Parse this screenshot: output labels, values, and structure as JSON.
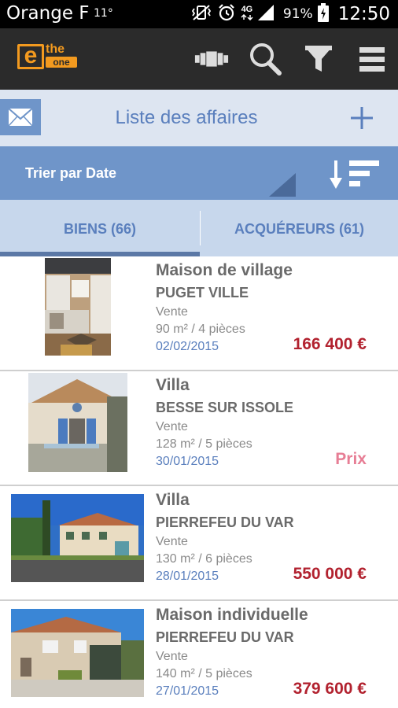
{
  "status_bar": {
    "carrier": "Orange F",
    "temperature": "11°",
    "network": "4G",
    "battery": "91%",
    "time": "12:50"
  },
  "app_bar": {
    "logo_text_top": "the",
    "logo_text_bottom": "one",
    "logo_letter": "e",
    "colors": {
      "background": "#2b2b2b",
      "logo": "#f39a1f"
    }
  },
  "header": {
    "title": "Liste des affaires"
  },
  "sort": {
    "label": "Trier par Date"
  },
  "tabs": [
    {
      "label": "BIENS (66)",
      "active": true
    },
    {
      "label": "ACQUÉREURS (61)",
      "active": false
    }
  ],
  "listings": [
    {
      "type": "Maison de village",
      "city": "PUGET VILLE",
      "deal": "Vente",
      "size": "90 m² / 4 pièces",
      "date": "02/02/2015",
      "price": "166 400 €"
    },
    {
      "type": "Villa",
      "city": "BESSE SUR ISSOLE",
      "deal": "Vente",
      "size": "128 m² / 5 pièces",
      "date": "30/01/2015",
      "price": "Prix"
    },
    {
      "type": "Villa",
      "city": "PIERREFEU DU VAR",
      "deal": "Vente",
      "size": "130 m² / 6 pièces",
      "date": "28/01/2015",
      "price": "550 000 €"
    },
    {
      "type": "Maison individuelle",
      "city": "PIERREFEU DU VAR",
      "deal": "Vente",
      "size": "140 m² / 5 pièces",
      "date": "27/01/2015",
      "price": "379 600 €"
    }
  ],
  "colors": {
    "accent": "#6f95c9",
    "title_text": "#5a7fbd",
    "price": "#b2222f",
    "price_placeholder": "#e77e95"
  }
}
